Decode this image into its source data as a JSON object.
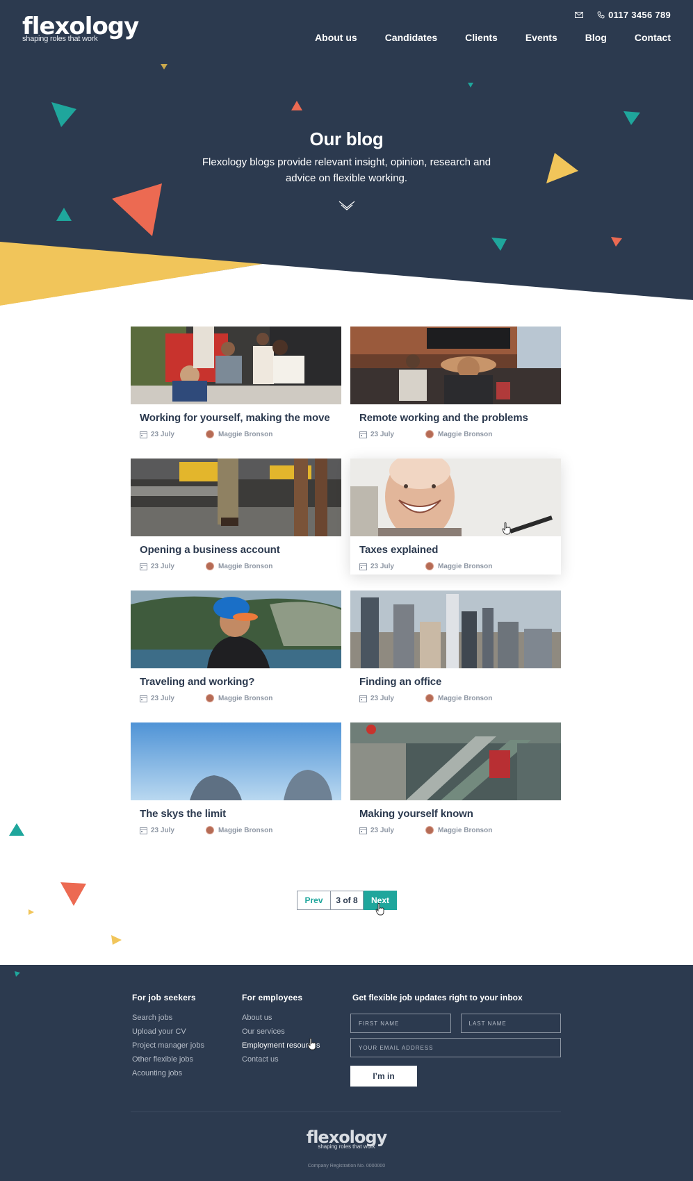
{
  "brand": {
    "logo_text": "flexology",
    "tagline": "shaping roles that work",
    "colors": {
      "navy": "#2c3a4f",
      "teal": "#1fa69c",
      "coral": "#ec6a52",
      "yellow": "#f1c55a"
    }
  },
  "header": {
    "mail_icon": "envelope-icon",
    "phone": "0117 3456 789",
    "nav": [
      "About us",
      "Candidates",
      "Clients",
      "Events",
      "Blog",
      "Contact"
    ]
  },
  "hero": {
    "title": "Our blog",
    "subtitle": "Flexology blogs provide relevant insight, opinion, research and advice on flexible working.",
    "scroll_icon": "chevron-down-icon"
  },
  "posts": [
    {
      "title": "Working for yourself, making the move",
      "date": "23 July",
      "author": "Maggie Bronson"
    },
    {
      "title": "Remote working and the problems",
      "date": "23 July",
      "author": "Maggie Bronson"
    },
    {
      "title": "Opening a business account",
      "date": "23 July",
      "author": "Maggie Bronson"
    },
    {
      "title": "Taxes explained",
      "date": "23 July",
      "author": "Maggie Bronson"
    },
    {
      "title": "Traveling and working?",
      "date": "23 July",
      "author": "Maggie Bronson"
    },
    {
      "title": "Finding an office",
      "date": "23 July",
      "author": "Maggie Bronson"
    },
    {
      "title": "The skys the limit",
      "date": "23 July",
      "author": "Maggie Bronson"
    },
    {
      "title": "Making yourself known",
      "date": "23 July",
      "author": "Maggie Bronson"
    }
  ],
  "pagination": {
    "prev": "Prev",
    "current": "3 of 8",
    "next": "Next"
  },
  "footer": {
    "job_seekers": {
      "heading": "For job seekers",
      "links": [
        "Search jobs",
        "Upload your CV",
        "Project manager jobs",
        "Other flexible jobs",
        "Acounting jobs"
      ]
    },
    "employees": {
      "heading": "For employees",
      "links": [
        "About us",
        "Our services",
        "Employment resources",
        "Contact us"
      ]
    },
    "newsletter": {
      "heading": "Get flexible job updates right to your inbox",
      "first_name_placeholder": "FIRST NAME",
      "last_name_placeholder": "LAST NAME",
      "email_placeholder": "YOUR EMAIL ADDRESS",
      "submit": "I’m in"
    },
    "logo_text": "flexology",
    "tagline": "shaping roles that work",
    "registration": "Company Registration No. 0000000"
  }
}
